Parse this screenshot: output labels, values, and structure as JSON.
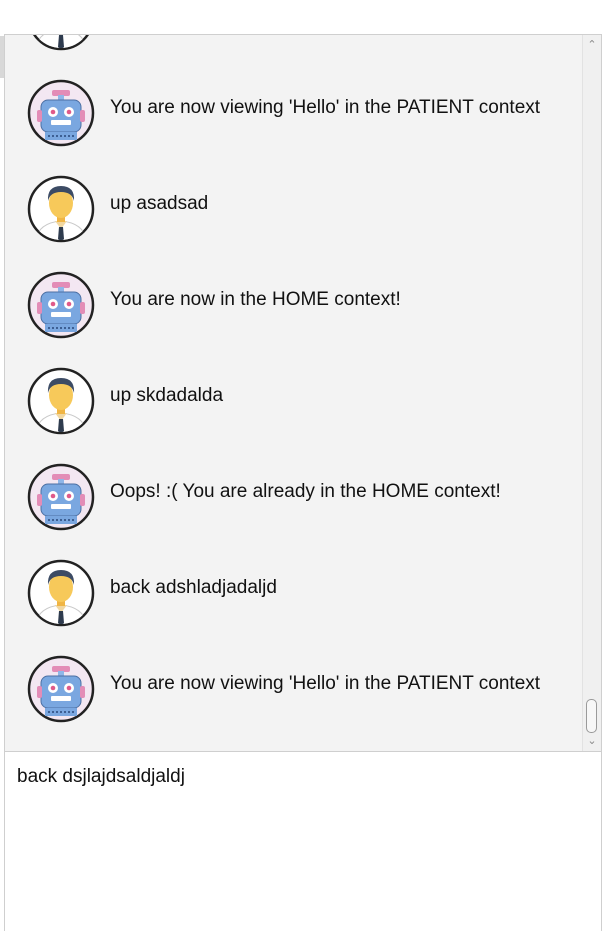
{
  "messages": [
    {
      "sender": "user",
      "icon": "user-avatar-icon",
      "text": ""
    },
    {
      "sender": "bot",
      "icon": "robot-avatar-icon",
      "text": "You are now viewing 'Hello' in the PATIENT context"
    },
    {
      "sender": "user",
      "icon": "user-avatar-icon",
      "text": "up asadsad"
    },
    {
      "sender": "bot",
      "icon": "robot-avatar-icon",
      "text": "You are now in the HOME context!"
    },
    {
      "sender": "user",
      "icon": "user-avatar-icon",
      "text": "up skdadalda"
    },
    {
      "sender": "bot",
      "icon": "robot-avatar-icon",
      "text": "Oops! :( You are already in the HOME context!"
    },
    {
      "sender": "user",
      "icon": "user-avatar-icon",
      "text": "back adshladjadaljd"
    },
    {
      "sender": "bot",
      "icon": "robot-avatar-icon",
      "text": "You are now viewing 'Hello' in the PATIENT context"
    }
  ],
  "input": {
    "value": "back dsjlajdsaldjaldj"
  },
  "scrollbar": {
    "position_fraction": 1.0
  },
  "colors": {
    "panel_bg": "#f3f3f3",
    "robot_blue": "#7aa7e0",
    "user_skin": "#f7c95a"
  }
}
